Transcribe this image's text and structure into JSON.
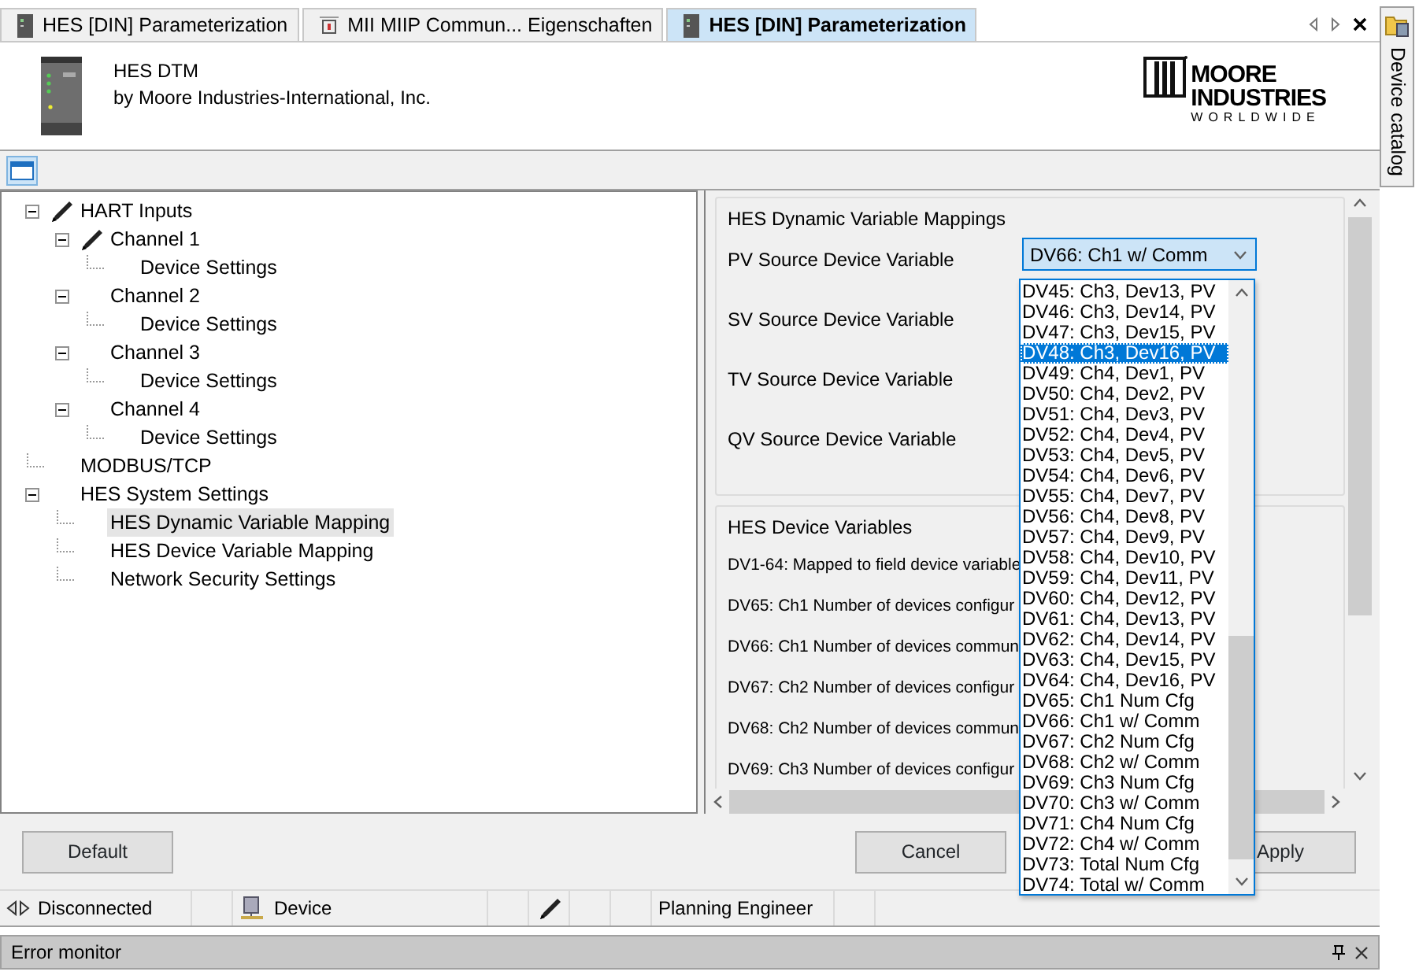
{
  "tabs": [
    {
      "label": "HES [DIN] Parameterization",
      "selected": false,
      "kind": "device"
    },
    {
      "label": "MII MIIP Commun... Eigenschaften",
      "selected": false,
      "kind": "comm"
    },
    {
      "label": "HES [DIN] Parameterization",
      "selected": true,
      "kind": "device"
    }
  ],
  "header": {
    "title": "HES DTM",
    "vendor": "by Moore Industries-International, Inc.",
    "logo": [
      "MOORE",
      "INDUSTRIES",
      "WORLDWIDE"
    ]
  },
  "tree": [
    {
      "label": "HART Inputs",
      "modified": true,
      "expanded": true,
      "selected": false,
      "children": [
        {
          "label": "Channel 1",
          "modified": true,
          "expanded": true,
          "selected": false,
          "children": [
            {
              "label": "Device Settings",
              "modified": false,
              "selected": false
            }
          ]
        },
        {
          "label": "Channel 2",
          "modified": false,
          "expanded": true,
          "selected": false,
          "children": [
            {
              "label": "Device Settings",
              "modified": false,
              "selected": false
            }
          ]
        },
        {
          "label": "Channel 3",
          "modified": false,
          "expanded": true,
          "selected": false,
          "children": [
            {
              "label": "Device Settings",
              "modified": false,
              "selected": false
            }
          ]
        },
        {
          "label": "Channel 4",
          "modified": false,
          "expanded": true,
          "selected": false,
          "children": [
            {
              "label": "Device Settings",
              "modified": false,
              "selected": false
            }
          ]
        }
      ]
    },
    {
      "label": "MODBUS/TCP",
      "modified": false,
      "selected": false
    },
    {
      "label": "HES System Settings",
      "modified": false,
      "expanded": true,
      "selected": false,
      "children": [
        {
          "label": "HES Dynamic Variable Mapping",
          "modified": false,
          "selected": true
        },
        {
          "label": "HES Device Variable Mapping",
          "modified": false,
          "selected": false
        },
        {
          "label": "Network Security Settings",
          "modified": false,
          "selected": false
        }
      ]
    }
  ],
  "mappings": {
    "title": "HES Dynamic Variable Mappings",
    "rows": [
      {
        "label": "PV Source Device Variable",
        "value": "DV66: Ch1 w/ Comm",
        "expanded": true
      },
      {
        "label": "SV Source Device Variable"
      },
      {
        "label": "TV Source Device Variable"
      },
      {
        "label": "QV Source Device Variable"
      }
    ]
  },
  "dropdown": {
    "options": [
      {
        "label": "DV45: Ch3, Dev13, PV",
        "selected": false
      },
      {
        "label": "DV46: Ch3, Dev14, PV",
        "selected": false
      },
      {
        "label": "DV47: Ch3, Dev15, PV",
        "selected": false
      },
      {
        "label": "DV48: Ch3, Dev16, PV",
        "selected": true
      },
      {
        "label": "DV49: Ch4, Dev1, PV",
        "selected": false
      },
      {
        "label": "DV50: Ch4, Dev2, PV",
        "selected": false
      },
      {
        "label": "DV51: Ch4, Dev3, PV",
        "selected": false
      },
      {
        "label": "DV52: Ch4, Dev4, PV",
        "selected": false
      },
      {
        "label": "DV53: Ch4, Dev5, PV",
        "selected": false
      },
      {
        "label": "DV54: Ch4, Dev6, PV",
        "selected": false
      },
      {
        "label": "DV55: Ch4, Dev7, PV",
        "selected": false
      },
      {
        "label": "DV56: Ch4, Dev8, PV",
        "selected": false
      },
      {
        "label": "DV57: Ch4, Dev9, PV",
        "selected": false
      },
      {
        "label": "DV58: Ch4, Dev10, PV",
        "selected": false
      },
      {
        "label": "DV59: Ch4, Dev11, PV",
        "selected": false
      },
      {
        "label": "DV60: Ch4, Dev12, PV",
        "selected": false
      },
      {
        "label": "DV61: Ch4, Dev13, PV",
        "selected": false
      },
      {
        "label": "DV62: Ch4, Dev14, PV",
        "selected": false
      },
      {
        "label": "DV63: Ch4, Dev15, PV",
        "selected": false
      },
      {
        "label": "DV64: Ch4, Dev16, PV",
        "selected": false
      },
      {
        "label": "DV65: Ch1 Num Cfg",
        "selected": false
      },
      {
        "label": "DV66: Ch1 w/ Comm",
        "selected": false
      },
      {
        "label": "DV67: Ch2 Num Cfg",
        "selected": false
      },
      {
        "label": "DV68: Ch2 w/ Comm",
        "selected": false
      },
      {
        "label": "DV69: Ch3 Num Cfg",
        "selected": false
      },
      {
        "label": "DV70: Ch3 w/ Comm",
        "selected": false
      },
      {
        "label": "DV71: Ch4 Num Cfg",
        "selected": false
      },
      {
        "label": "DV72: Ch4 w/ Comm",
        "selected": false
      },
      {
        "label": "DV73: Total Num Cfg",
        "selected": false
      },
      {
        "label": "DV74: Total w/ Comm",
        "selected": false
      }
    ]
  },
  "device_variables": {
    "title": "HES Device Variables",
    "rows": [
      "DV1-64: Mapped to field device variable",
      "DV65: Ch1 Number of devices configur",
      "DV66: Ch1 Number of devices commun",
      "DV67: Ch2 Number of devices configur",
      "DV68: Ch2 Number of devices commun",
      "DV69: Ch3 Number of devices configur"
    ]
  },
  "buttons": [
    "Default",
    "Cancel",
    "Apply"
  ],
  "status_bar": [
    {
      "kind": "connection",
      "text": "Disconnected"
    },
    {
      "kind": "device",
      "text": "Device"
    },
    {
      "kind": "edit"
    },
    {
      "kind": "user",
      "text": "Planning Engineer"
    }
  ],
  "error_monitor": {
    "title": "Error monitor"
  },
  "side_panel": {
    "title": "Device catalog"
  }
}
